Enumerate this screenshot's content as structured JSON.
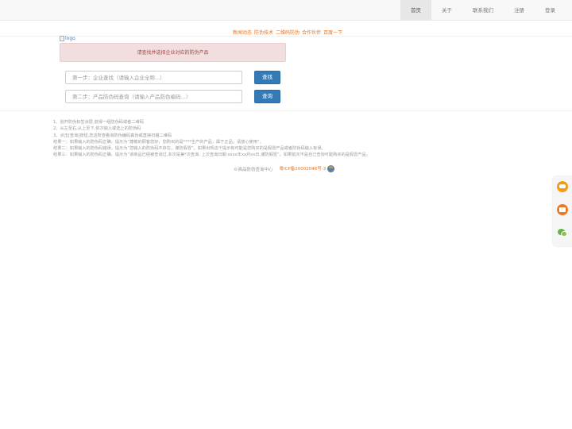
{
  "nav": {
    "items": [
      "首页",
      "关于",
      "联系我们",
      "注册",
      "登录"
    ],
    "active_index": 0
  },
  "top_links": [
    "新闻动态",
    "防伪技术",
    "二维码防伪",
    "合作伙伴",
    "百度一下"
  ],
  "logo_alt": "logo",
  "alert": {
    "text": "请查找并选择企业对应的防伪产品"
  },
  "search": {
    "company_placeholder": "第一步：企业查找（请输入企业全称...）",
    "company_button": "查找",
    "product_placeholder": "第二步：产品防伪码查询（请输入产品防伪编码...）",
    "product_button": "查询"
  },
  "instructions": [
    "1、刮开防伪标签涂层,获得一组防伪码或者二维码",
    "2、从左至右,从上至下,依次输入或选上的防伪码",
    "3、点击[查询]按钮,您这所查看询防伪编码真伪或直接扫描二维码",
    "结果一：如果输入的防伪码正确，提示为“尊敬的顾客您好，您购买的是****生产的产品，属于正品，请放心使用”。",
    "结果二：如果输入的防伪码错误，提示为“您输入的防伪码不存在，谨防假冒”。如果出现这个提示有可能是您购买的是假冒产品或者防伪码输入有误。",
    "结果三：如果输入的防伪码正确，提示为“该商品已经被查询过,本次是第*次查询, 上次查询日期:xxxx年xx月xx日,谨防假冒”。如果前次不是自己查询可能购买的是假冒产品。"
  ],
  "footer": {
    "copyright": "©商品防伪查询中心",
    "icp": "粤ICP备20002046号-3"
  },
  "colors": {
    "accent": "#e8731c",
    "button": "#337ab7",
    "alert_bg": "#f2dede",
    "alert_text": "#a94442"
  }
}
